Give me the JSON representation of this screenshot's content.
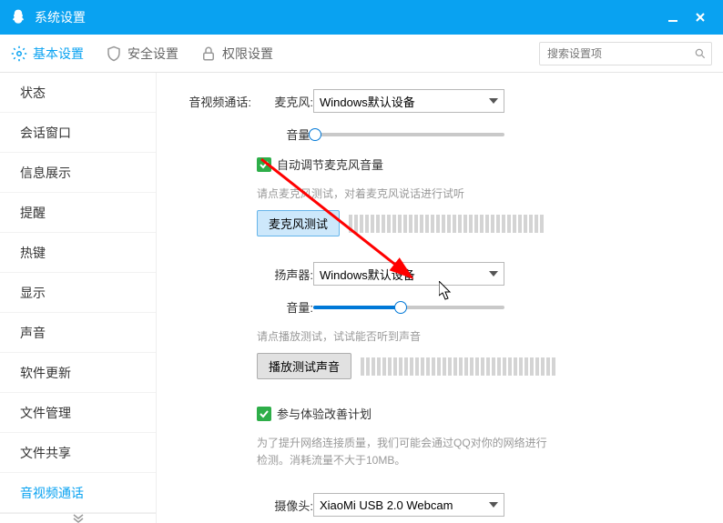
{
  "titlebar": {
    "title": "系统设置"
  },
  "tabs": {
    "basic": "基本设置",
    "security": "安全设置",
    "permission": "权限设置"
  },
  "search": {
    "placeholder": "搜索设置项"
  },
  "sidebar": {
    "items": [
      "状态",
      "会话窗口",
      "信息展示",
      "提醒",
      "热键",
      "显示",
      "声音",
      "软件更新",
      "文件管理",
      "文件共享",
      "音视频通话"
    ],
    "activeIndex": 10
  },
  "main": {
    "section_label": "音视频通话:",
    "mic_label": "麦克风:",
    "mic_device": "Windows默认设备",
    "volume_label": "音量:",
    "auto_adjust_mic": "自动调节麦克风音量",
    "mic_test_hint": "请点麦克风测试，对着麦克风说话进行试听",
    "mic_test_btn": "麦克风测试",
    "speaker_label": "扬声器:",
    "speaker_device": "Windows默认设备",
    "speaker_test_hint": "请点播放测试，试试能否听到声音",
    "speaker_test_btn": "播放测试声音",
    "improvement_label": "参与体验改善计划",
    "improvement_hint": "为了提升网络连接质量，我们可能会通过QQ对你的网络进行检测。消耗流量不大于10MB。",
    "camera_label": "摄像头:",
    "camera_device": "XiaoMi USB 2.0 Webcam"
  }
}
